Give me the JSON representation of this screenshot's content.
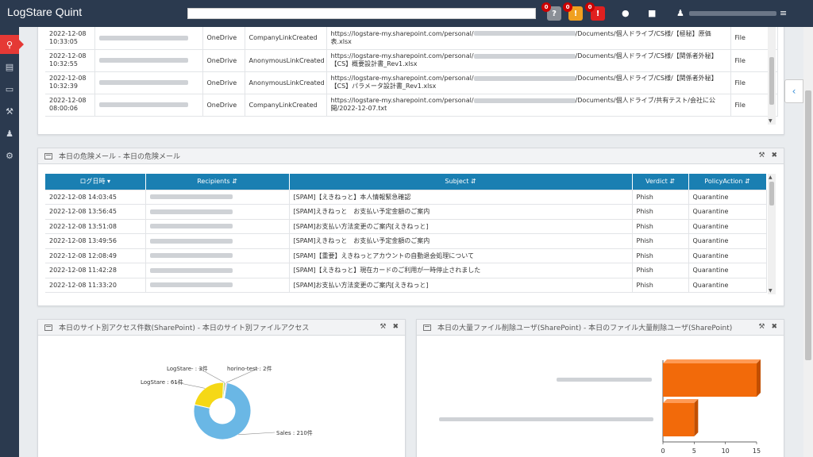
{
  "app": {
    "title": "LogStare Quint"
  },
  "header": {
    "search": {
      "value": "",
      "placeholder": ""
    },
    "alerts": [
      {
        "count": "0",
        "symbol": "?",
        "color": "#8a8f96"
      },
      {
        "count": "0",
        "symbol": "!",
        "color": "#f0a020"
      },
      {
        "count": "0",
        "symbol": "!",
        "color": "#e02020"
      }
    ],
    "icons": [
      "alert-icon",
      "chat-icon",
      "user-icon",
      "menu-icon"
    ]
  },
  "sidebar": {
    "items": [
      "search-icon",
      "dashboard-icon",
      "report-icon",
      "wrench-icon",
      "users-icon",
      "settings-icon"
    ]
  },
  "share_table": {
    "rows": [
      {
        "date": "2022-12-08",
        "time": "10:33:05",
        "workload": "OneDrive",
        "operation": "CompanyLinkCreated",
        "url_prefix": "https://logstare-my.sharepoint.com/personal/",
        "url_suffix": "/Documents/個人ドライブ/CS様/【極秘】原価表.xlsx",
        "type": "File"
      },
      {
        "date": "2022-12-08",
        "time": "10:32:55",
        "workload": "OneDrive",
        "operation": "AnonymousLinkCreated",
        "url_prefix": "https://logstare-my.sharepoint.com/personal/",
        "url_suffix": "/Documents/個人ドライブ/CS様/【関係者外秘】【CS】概要設計書_Rev1.xlsx",
        "type": "File"
      },
      {
        "date": "2022-12-08",
        "time": "10:32:39",
        "workload": "OneDrive",
        "operation": "AnonymousLinkCreated",
        "url_prefix": "https://logstare-my.sharepoint.com/personal/",
        "url_suffix": "/Documents/個人ドライブ/CS様/【関係者外秘】【CS】パラメータ設計書_Rev1.xlsx",
        "type": "File"
      },
      {
        "date": "2022-12-08",
        "time": "08:00:06",
        "workload": "OneDrive",
        "operation": "CompanyLinkCreated",
        "url_prefix": "https://logstare-my.sharepoint.com/personal/",
        "url_suffix": "/Documents/個人ドライブ/共有テスト/会社に公開/2022-12-07.txt",
        "type": "File"
      }
    ]
  },
  "mail_panel": {
    "title": "本日の危険メール - 本日の危険メール",
    "columns": [
      "ログ日時",
      "Recipients",
      "Subject",
      "Verdict",
      "PolicyAction"
    ],
    "rows": [
      {
        "time": "2022-12-08 14:03:45",
        "subject": "[SPAM]【えきねっと】本人情報緊急確認",
        "verdict": "Phish",
        "action": "Quarantine"
      },
      {
        "time": "2022-12-08 13:56:45",
        "subject": "[SPAM]えきねっと　お支払い予定金額のご案内",
        "verdict": "Phish",
        "action": "Quarantine"
      },
      {
        "time": "2022-12-08 13:51:08",
        "subject": "[SPAM]お支払い方法変更のご案内[えきねっと]",
        "verdict": "Phish",
        "action": "Quarantine"
      },
      {
        "time": "2022-12-08 13:49:56",
        "subject": "[SPAM]えきねっと　お支払い予定金額のご案内",
        "verdict": "Phish",
        "action": "Quarantine"
      },
      {
        "time": "2022-12-08 12:08:49",
        "subject": "[SPAM]【重要】えきねっとアカウントの自動退会処理について",
        "verdict": "Phish",
        "action": "Quarantine"
      },
      {
        "time": "2022-12-08 11:42:28",
        "subject": "[SPAM]【えきねっと】現在カードのご利用が一時停止されました",
        "verdict": "Phish",
        "action": "Quarantine"
      },
      {
        "time": "2022-12-08 11:33:20",
        "subject": "[SPAM]お支払い方法変更のご案内[えきねっと]",
        "verdict": "Phish",
        "action": "Quarantine"
      }
    ]
  },
  "site_panel": {
    "title": "本日のサイト別アクセス件数(SharePoint) - 本日のサイト別ファイルアクセス"
  },
  "delete_panel": {
    "title": "本日の大量ファイル削除ユーザ(SharePoint) - 本日のファイル大量削除ユーザ(SharePoint)"
  },
  "chart_data": [
    {
      "type": "pie",
      "categories": [
        "Sales",
        "LogStare",
        "LogStare-",
        "horino-test"
      ],
      "values": [
        210,
        61,
        3,
        2
      ],
      "labels": [
        "Sales : 210件",
        "LogStare : 61件",
        "LogStare- : 3件",
        "horino-test : 2件"
      ],
      "colors": [
        "#6ab7e5",
        "#f5d816",
        "#9fd36a",
        "#c06ad8"
      ]
    },
    {
      "type": "bar",
      "orientation": "horizontal",
      "values": [
        15,
        5
      ],
      "xlim": [
        0,
        15
      ],
      "x_ticks": [
        "0",
        "5",
        "10",
        "15"
      ],
      "color": "#f26a0a"
    }
  ]
}
